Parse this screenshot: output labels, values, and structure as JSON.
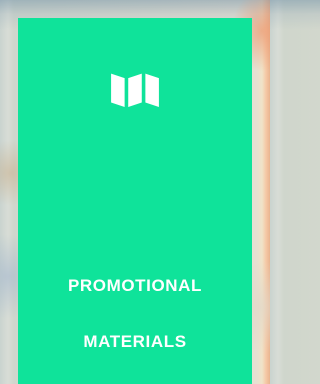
{
  "card": {
    "title_line1": "PROMOTIONAL",
    "title_line2": "MATERIALS",
    "icon": "folded-map-icon",
    "background_color": "#0fe39a",
    "text_color": "#ffffff"
  }
}
